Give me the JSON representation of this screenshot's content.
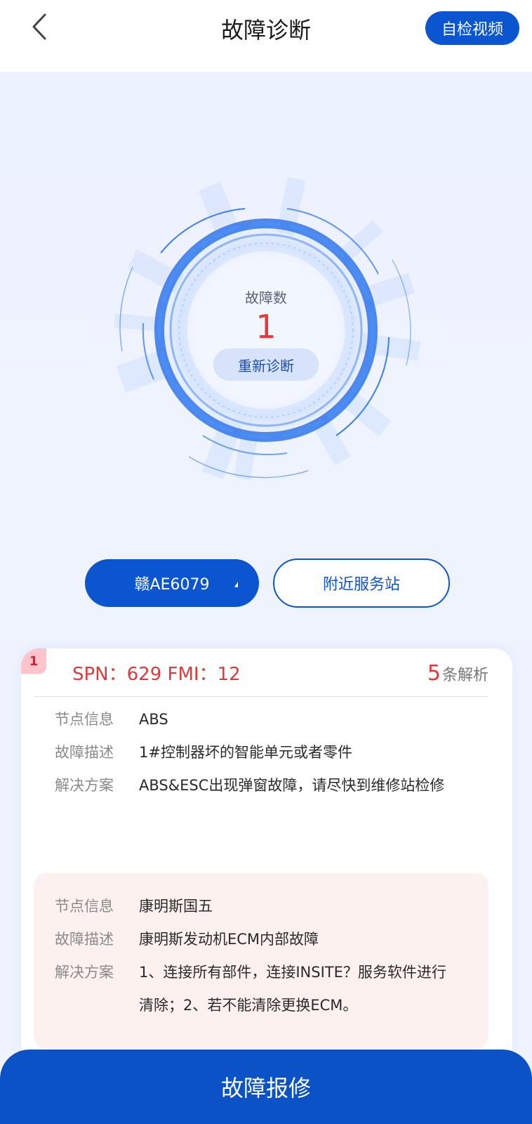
{
  "header": {
    "title": "故障诊断",
    "video_button": "自检视频",
    "back_icon": "chevron-left-icon"
  },
  "diagnosis": {
    "fault_label": "故障数",
    "fault_count": "1",
    "rediagnose_button": "重新诊断"
  },
  "actions": {
    "plate_value": "赣AE6079",
    "plate_caret_icon": "caret-down-icon",
    "nearby_station_button": "附近服务站"
  },
  "fault_card": {
    "index": "1",
    "spn_code": "SPN：629 FMI：12",
    "analysis_count": "5",
    "analysis_suffix": "条解析",
    "entries": [
      {
        "node_label": "节点信息",
        "node_value": "ABS",
        "desc_label": "故障描述",
        "desc_value": "1#控制器坏的智能单元或者零件",
        "solution_label": "解决方案",
        "solution_value": "ABS&ESC出现弹窗故障，请尽快到维修站检修"
      },
      {
        "node_label": "节点信息",
        "node_value": "康明斯国五",
        "desc_label": "故障描述",
        "desc_value": "康明斯发动机ECM内部故障",
        "solution_label": "解决方案",
        "solution_value": "1、连接所有部件，连接INSITE？服务软件进行清除；2、若不能清除更换ECM。"
      }
    ]
  },
  "footer": {
    "repair_button": "故障报修"
  },
  "colors": {
    "primary_blue": "#0b56d0",
    "fault_red": "#dc3b3b",
    "background": "#eef3ff"
  }
}
